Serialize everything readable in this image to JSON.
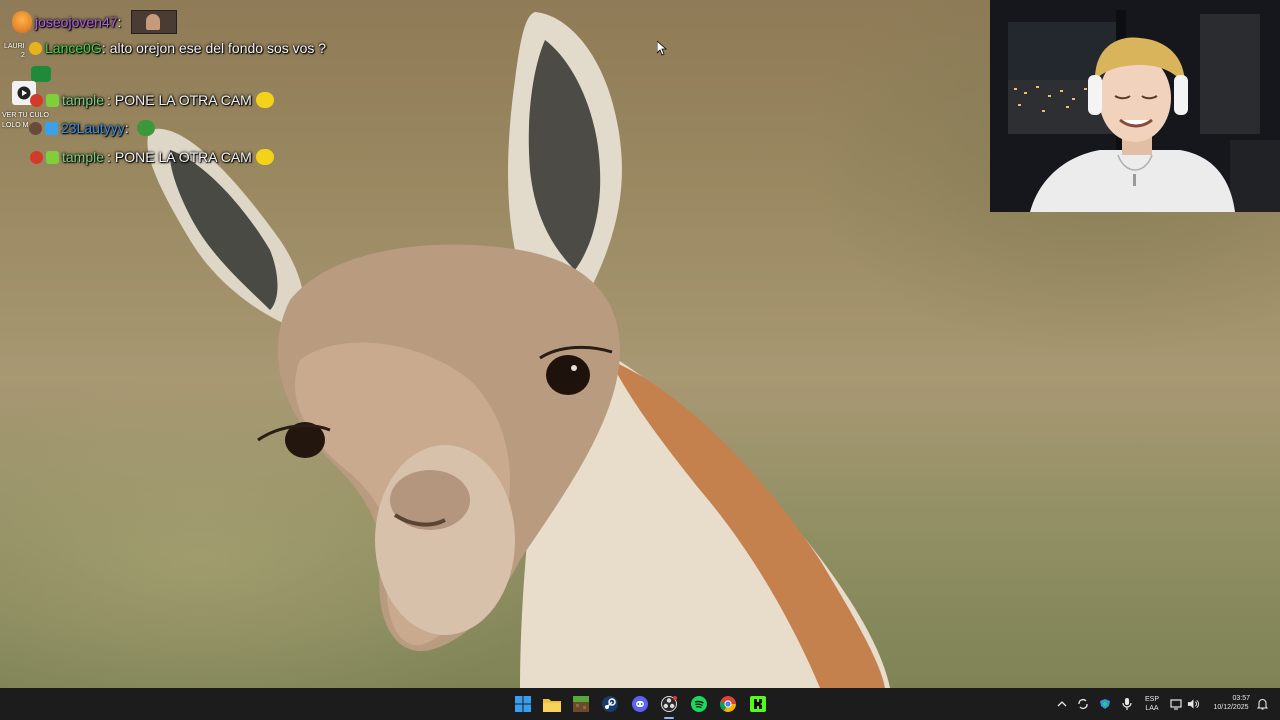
{
  "chat": {
    "messages": [
      {
        "user": "joseojoven47",
        "separator": ":",
        "text": "",
        "user_color": "#b05ee6"
      },
      {
        "user": "Lance0G",
        "separator": ":",
        "text": "alto orejon ese del fondo sos vos ?",
        "user_color": "#46d24a"
      },
      {
        "user": "tample",
        "separator": ":",
        "text": "PONE LA OTRA CAM",
        "user_color": "#7ecf7e"
      },
      {
        "user": "23Lautyyy",
        "separator": ":",
        "text": "",
        "user_color": "#3a8fe0"
      },
      {
        "user": "tample",
        "separator": ":",
        "text": "PONE LA OTRA CAM",
        "user_color": "#7ecf7e"
      }
    ],
    "side_labels": {
      "lauri": "LAURI",
      "lauri_num": "2",
      "ver_tu_culo": "VER TU CULO",
      "lolo": "LOLO M"
    }
  },
  "taskbar": {
    "apps": [
      {
        "name": "start",
        "icon": "windows-icon"
      },
      {
        "name": "file-explorer",
        "icon": "folder-icon"
      },
      {
        "name": "minecraft",
        "icon": "grass-block-icon"
      },
      {
        "name": "steam",
        "icon": "steam-icon"
      },
      {
        "name": "discord",
        "icon": "discord-icon"
      },
      {
        "name": "obs",
        "icon": "obs-icon"
      },
      {
        "name": "spotify",
        "icon": "spotify-icon"
      },
      {
        "name": "chrome",
        "icon": "chrome-icon"
      },
      {
        "name": "kick",
        "icon": "kick-icon"
      }
    ],
    "tray": {
      "lang_top": "ESP",
      "lang_bottom": "LAA",
      "time": "03:57",
      "date": "10/12/2025"
    }
  },
  "colors": {
    "taskbar_bg": "#1c1c1c",
    "accent_blue": "#3a8fe0"
  }
}
